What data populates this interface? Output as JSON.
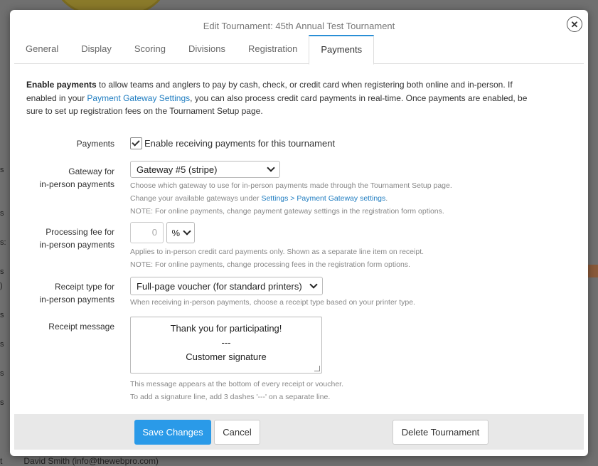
{
  "background": {
    "fragments": [
      "s",
      "s",
      "s:",
      "s",
      ")",
      "s",
      "s",
      "s",
      "s"
    ],
    "footer_prefix": "t",
    "footer_text": "David Smith (info@thewebpro.com)"
  },
  "modal": {
    "title": "Edit Tournament: 45th Annual Test Tournament",
    "close_icon": "close-icon"
  },
  "tabs": [
    {
      "label": "General",
      "active": false
    },
    {
      "label": "Display",
      "active": false
    },
    {
      "label": "Scoring",
      "active": false
    },
    {
      "label": "Divisions",
      "active": false
    },
    {
      "label": "Registration",
      "active": false
    },
    {
      "label": "Payments",
      "active": true
    }
  ],
  "intro": {
    "bold": "Enable payments",
    "text1": " to allow teams and anglers to pay by cash, check, or credit card when registering both online and in-person. If enabled in your ",
    "link": "Payment Gateway Settings",
    "text2": ", you can also process credit card payments in real-time. Once payments are enabled, be sure to set up registration fees on the Tournament Setup page."
  },
  "payments": {
    "label": "Payments",
    "checkbox_label": "Enable receiving payments for this tournament",
    "checked": true
  },
  "gateway": {
    "label_line1": "Gateway for",
    "label_line2": "in-person payments",
    "selected": "Gateway #5 (stripe)",
    "help1": "Choose which gateway to use for in-person payments made through the Tournament Setup page.",
    "help2_prefix": "Change your available gateways under ",
    "help2_link": "Settings > Payment Gateway settings",
    "help2_suffix": ".",
    "help3": "NOTE: For online payments, change payment gateway settings in the registration form options."
  },
  "processing_fee": {
    "label_line1": "Processing fee for",
    "label_line2": "in-person payments",
    "value": "0",
    "unit": "%",
    "help1": "Applies to in-person credit card payments only. Shown as a separate line item on receipt.",
    "help2": "NOTE: For online payments, change processing fees in the registration form options."
  },
  "receipt_type": {
    "label_line1": "Receipt type for",
    "label_line2": "in-person payments",
    "selected": "Full-page voucher (for standard printers)",
    "help": "When receiving in-person payments, choose a receipt type based on your printer type."
  },
  "receipt_message": {
    "label": "Receipt message",
    "line1": "Thank you for participating!",
    "line2": "---",
    "line3": "Customer signature",
    "help1": "This message appears at the bottom of every receipt or voucher.",
    "help2": "To add a signature line, add 3 dashes '---' on a separate line."
  },
  "footer": {
    "save": "Save Changes",
    "cancel": "Cancel",
    "delete": "Delete Tournament"
  },
  "colors": {
    "accent": "#2a9ae8",
    "link": "#1e7cc0",
    "footer_bg": "#e8e8e8"
  }
}
